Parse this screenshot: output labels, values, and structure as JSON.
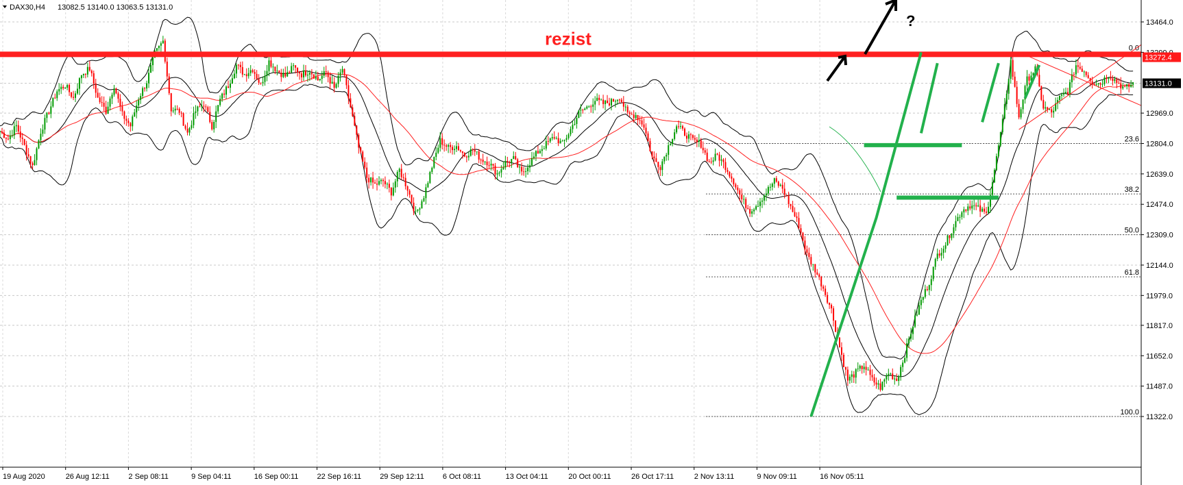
{
  "header": {
    "symbol": "DAX30,H4",
    "ohlc": "13082.5 13140.0 13063.5 13131.0"
  },
  "chart_data": {
    "type": "candlestick",
    "symbol": "DAX30",
    "timeframe": "H4",
    "ylim": [
      11322.0,
      13464.0
    ],
    "y_ticks": [
      13464.0,
      13299.0,
      13131.0,
      12969.0,
      12804.0,
      12639.0,
      12474.0,
      12309.0,
      12144.0,
      11979.0,
      11817.0,
      11652.0,
      11487.0,
      11322.0
    ],
    "y_tick_labels": [
      "13464.0",
      "13299.0",
      "12969.0",
      "12804.0",
      "12639.0",
      "12474.0",
      "12309.0",
      "12144.0",
      "11979.0",
      "11817.0",
      "11652.0",
      "11487.0",
      "11322.0"
    ],
    "x_tick_labels": [
      "19 Aug 2020",
      "26 Aug 12:11",
      "2 Sep 08:11",
      "9 Sep 04:11",
      "16 Sep 00:11",
      "22 Sep 16:11",
      "29 Sep 12:11",
      "6 Oct 08:11",
      "13 Oct 04:11",
      "20 Oct 00:11",
      "26 Oct 17:11",
      "2 Nov 13:11",
      "9 Nov 09:11",
      "16 Nov 05:11"
    ],
    "price_labels": [
      {
        "text": "13272.4",
        "value": 13272.4,
        "color": "#ff1a1a"
      },
      {
        "text": "13131.0",
        "value": 13131.0,
        "color": "#000000"
      }
    ],
    "fibonacci": [
      {
        "level": "0.0",
        "price": 13299.0
      },
      {
        "level": "23.6",
        "price": 12804.0
      },
      {
        "level": "38.2",
        "price": 12530.0
      },
      {
        "level": "50.0",
        "price": 12309.0
      },
      {
        "level": "61.8",
        "price": 12080.0
      },
      {
        "level": "100.0",
        "price": 11322.0
      }
    ],
    "annotations": {
      "resistance_label": "rezist",
      "question_mark": "?",
      "resistance_price": 13288.0
    },
    "close_path": [
      [
        0,
        12870
      ],
      [
        4,
        12830
      ],
      [
        8,
        12900
      ],
      [
        12,
        12790
      ],
      [
        16,
        12680
      ],
      [
        20,
        12870
      ],
      [
        24,
        12980
      ],
      [
        28,
        13090
      ],
      [
        32,
        13120
      ],
      [
        36,
        13050
      ],
      [
        40,
        13180
      ],
      [
        44,
        13210
      ],
      [
        48,
        13050
      ],
      [
        52,
        12980
      ],
      [
        56,
        13120
      ],
      [
        60,
        12960
      ],
      [
        64,
        12900
      ],
      [
        68,
        13050
      ],
      [
        72,
        13140
      ],
      [
        76,
        13290
      ],
      [
        80,
        13360
      ],
      [
        84,
        12990
      ],
      [
        88,
        12980
      ],
      [
        92,
        12860
      ],
      [
        96,
        12980
      ],
      [
        100,
        13020
      ],
      [
        104,
        12900
      ],
      [
        108,
        13040
      ],
      [
        112,
        13120
      ],
      [
        116,
        13230
      ],
      [
        120,
        13180
      ],
      [
        124,
        13210
      ],
      [
        128,
        13120
      ],
      [
        132,
        13250
      ],
      [
        136,
        13200
      ],
      [
        140,
        13170
      ],
      [
        144,
        13220
      ],
      [
        148,
        13180
      ],
      [
        152,
        13200
      ],
      [
        156,
        13150
      ],
      [
        160,
        13190
      ],
      [
        164,
        13100
      ],
      [
        168,
        13210
      ],
      [
        172,
        13000
      ],
      [
        176,
        12780
      ],
      [
        180,
        12620
      ],
      [
        184,
        12580
      ],
      [
        188,
        12600
      ],
      [
        192,
        12540
      ],
      [
        196,
        12660
      ],
      [
        200,
        12560
      ],
      [
        204,
        12420
      ],
      [
        208,
        12520
      ],
      [
        212,
        12680
      ],
      [
        216,
        12820
      ],
      [
        220,
        12780
      ],
      [
        224,
        12790
      ],
      [
        228,
        12740
      ],
      [
        232,
        12770
      ],
      [
        236,
        12720
      ],
      [
        240,
        12700
      ],
      [
        244,
        12640
      ],
      [
        248,
        12700
      ],
      [
        252,
        12720
      ],
      [
        256,
        12640
      ],
      [
        260,
        12700
      ],
      [
        264,
        12760
      ],
      [
        268,
        12800
      ],
      [
        272,
        12840
      ],
      [
        276,
        12800
      ],
      [
        280,
        12880
      ],
      [
        284,
        12970
      ],
      [
        288,
        13000
      ],
      [
        292,
        13040
      ],
      [
        296,
        13020
      ],
      [
        300,
        13030
      ],
      [
        304,
        13060
      ],
      [
        308,
        12960
      ],
      [
        312,
        12960
      ],
      [
        316,
        12900
      ],
      [
        320,
        12730
      ],
      [
        324,
        12680
      ],
      [
        328,
        12790
      ],
      [
        332,
        12900
      ],
      [
        336,
        12860
      ],
      [
        340,
        12820
      ],
      [
        344,
        12800
      ],
      [
        348,
        12700
      ],
      [
        352,
        12740
      ],
      [
        356,
        12680
      ],
      [
        360,
        12600
      ],
      [
        364,
        12500
      ],
      [
        368,
        12440
      ],
      [
        372,
        12480
      ],
      [
        376,
        12540
      ],
      [
        380,
        12600
      ],
      [
        384,
        12560
      ],
      [
        388,
        12460
      ],
      [
        392,
        12360
      ],
      [
        396,
        12200
      ],
      [
        400,
        12120
      ],
      [
        404,
        12020
      ],
      [
        408,
        11900
      ],
      [
        412,
        11700
      ],
      [
        416,
        11520
      ],
      [
        420,
        11560
      ],
      [
        424,
        11600
      ],
      [
        428,
        11520
      ],
      [
        432,
        11480
      ],
      [
        436,
        11560
      ],
      [
        440,
        11520
      ],
      [
        444,
        11660
      ],
      [
        448,
        11820
      ],
      [
        452,
        11950
      ],
      [
        456,
        12050
      ],
      [
        460,
        12200
      ],
      [
        464,
        12260
      ],
      [
        468,
        12360
      ],
      [
        472,
        12440
      ],
      [
        476,
        12470
      ],
      [
        480,
        12450
      ],
      [
        484,
        12420
      ],
      [
        488,
        12660
      ],
      [
        492,
        12920
      ],
      [
        496,
        13250
      ],
      [
        500,
        12950
      ],
      [
        504,
        13150
      ],
      [
        508,
        13210
      ],
      [
        512,
        13000
      ],
      [
        516,
        12970
      ],
      [
        520,
        13050
      ],
      [
        524,
        13090
      ],
      [
        528,
        13230
      ],
      [
        532,
        13200
      ],
      [
        536,
        13140
      ],
      [
        540,
        13130
      ],
      [
        544,
        13180
      ],
      [
        548,
        13140
      ],
      [
        552,
        13100
      ],
      [
        556,
        13131
      ]
    ],
    "resistance_line": [
      [
        0,
        13288.0
      ],
      [
        560,
        13288.0
      ]
    ],
    "trend_lines": [
      {
        "points": [
          [
            500,
            13300
          ],
          [
            560,
            13010
          ]
        ],
        "color": "#ff2020"
      },
      {
        "points": [
          [
            500,
            12880
          ],
          [
            560,
            13340
          ]
        ],
        "color": "#ff2020"
      }
    ],
    "green_zones": [
      {
        "x1": 424,
        "x2": 472,
        "price": 12795
      },
      {
        "x1": 440,
        "x2": 490,
        "price": 12510
      }
    ]
  }
}
